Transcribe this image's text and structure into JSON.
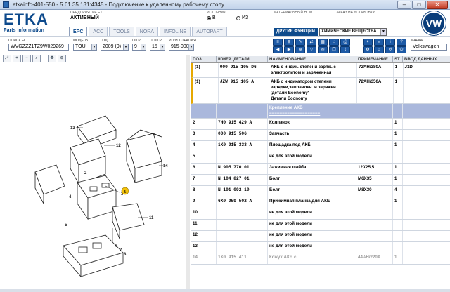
{
  "window": {
    "title": "etkainfo-401-550 - 5.61.35.131:4345 - Подключение к удаленному рабочему столу",
    "min": "–",
    "max": "□",
    "close": "✕"
  },
  "header": {
    "logo": "ETKA",
    "logo_sub": "Parts Information",
    "partner_label": "ПРЕДПРИЯТИЕ ЕТ",
    "partner_value": "АКТИВНЫЙ",
    "source_label": "ИСТОЧНИК",
    "radio_v": "В",
    "radio_iz": "ИЗ",
    "material_label": "МАТЕРИАЛЬНЫЙ НОМ.",
    "order_label": "ЗАКАЗ НА УСТАНОВКУ",
    "vw_badge": "VW"
  },
  "tabs": [
    {
      "label": "EPC",
      "active": true
    },
    {
      "label": "ACC",
      "active": false
    },
    {
      "label": "TOOLS",
      "active": false
    },
    {
      "label": "NORA",
      "active": false
    },
    {
      "label": "INFOLINE",
      "active": false
    },
    {
      "label": "AUTOPART",
      "active": false
    }
  ],
  "functions": {
    "label": "ДРУГИЕ ФУНКЦИИ",
    "selected": "ХИМИЧЕСКИЕ ВЕЩЕСТВА"
  },
  "fields": {
    "search_label": "ПОИСК FI",
    "search_value": "WVGZZZ1TZ9W029269",
    "model_label": "МОДЕЛЬ",
    "model_value": "TOU",
    "year_label": "ГОД",
    "year_value": "2009 (9)",
    "group_label": "ГЛГР",
    "group_value": "9",
    "subgroup_label": "ПОДГР",
    "subgroup_value": "15",
    "illustration_label": "ИЛЛЮСТРАЦИЯ",
    "illustration_value": "915-000",
    "brand_label": "МАРКА",
    "brand_value": "Volkswagen"
  },
  "grid": {
    "columns": [
      "ПОЗ.",
      "НОМЕР ДЕТАЛИ",
      "НАИМЕНОВАНИЕ",
      "ПРИМЕЧАНИЕ",
      "ST",
      "ВВОД ДАННЫХ"
    ],
    "rows": [
      {
        "pos": "(1)",
        "num": "000 915 105 D6",
        "name": "АКБ с индик. степени заряж.,с\nэлектролитом и заряженная",
        "note": "72AH/380A",
        "st": "1",
        "date": "J1D",
        "style": "gold"
      },
      {
        "pos": "(1)",
        "num": "JZW 915 105 A",
        "name": "АКБ с индикатором степени\nзарядки,заправлен. и заряжен.\n'детали Economy'\nДетали Economy",
        "note": "72AH/350A",
        "st": "1",
        "date": "",
        "style": "gold"
      },
      {
        "pos": "",
        "num": "",
        "name": "Крепление АКБ\n====================",
        "note": "",
        "st": "",
        "date": "",
        "style": "header-row"
      },
      {
        "pos": "2",
        "num": "7H0 915 429 A",
        "name": "Колпачок",
        "note": "",
        "st": "1",
        "date": "",
        "style": ""
      },
      {
        "pos": "3",
        "num": "000 915 506",
        "name": "Запчасть",
        "note": "",
        "st": "1",
        "date": "",
        "style": ""
      },
      {
        "pos": "4",
        "num": "1K0 915 333 A",
        "name": "Площадка под АКБ",
        "note": "",
        "st": "1",
        "date": "",
        "style": ""
      },
      {
        "pos": "5",
        "num": "",
        "name": "не для этой модели",
        "note": "",
        "st": "",
        "date": "",
        "style": ""
      },
      {
        "pos": "6",
        "num": "N 905 770 01",
        "name": "Зажимная шайба",
        "note": "12X25,5",
        "st": "1",
        "date": "",
        "style": ""
      },
      {
        "pos": "7",
        "num": "N 104 827 01",
        "name": "Болт",
        "note": "M6X35",
        "st": "1",
        "date": "",
        "style": ""
      },
      {
        "pos": "8",
        "num": "N 101 092 10",
        "name": "Болт",
        "note": "M8X30",
        "st": "4",
        "date": "",
        "style": ""
      },
      {
        "pos": "9",
        "num": "6X0 959 502 A",
        "name": "Прижимная планка для АКБ",
        "note": "",
        "st": "1",
        "date": "",
        "style": ""
      },
      {
        "pos": "10",
        "num": "",
        "name": "не для этой модели",
        "note": "",
        "st": "",
        "date": "",
        "style": ""
      },
      {
        "pos": "11",
        "num": "",
        "name": "не для этой модели",
        "note": "",
        "st": "",
        "date": "",
        "style": ""
      },
      {
        "pos": "12",
        "num": "",
        "name": "не для этой модели",
        "note": "",
        "st": "",
        "date": "",
        "style": ""
      },
      {
        "pos": "13",
        "num": "",
        "name": "не для этой модели",
        "note": "",
        "st": "",
        "date": "",
        "style": ""
      },
      {
        "pos": "14",
        "num": "1K0 915 411",
        "name": "Кожух АКБ с",
        "note": "44AH/220A",
        "st": "1",
        "date": "",
        "style": "faded"
      }
    ]
  },
  "diagram": {
    "callouts": [
      "13",
      "12",
      "14",
      "2",
      "1",
      "3",
      "4",
      "5",
      "11",
      "6",
      "7",
      "8"
    ]
  },
  "colors": {
    "brand": "#0d4a8c",
    "gold_marker": "#e6a800",
    "section_header": "#aab8dc"
  }
}
